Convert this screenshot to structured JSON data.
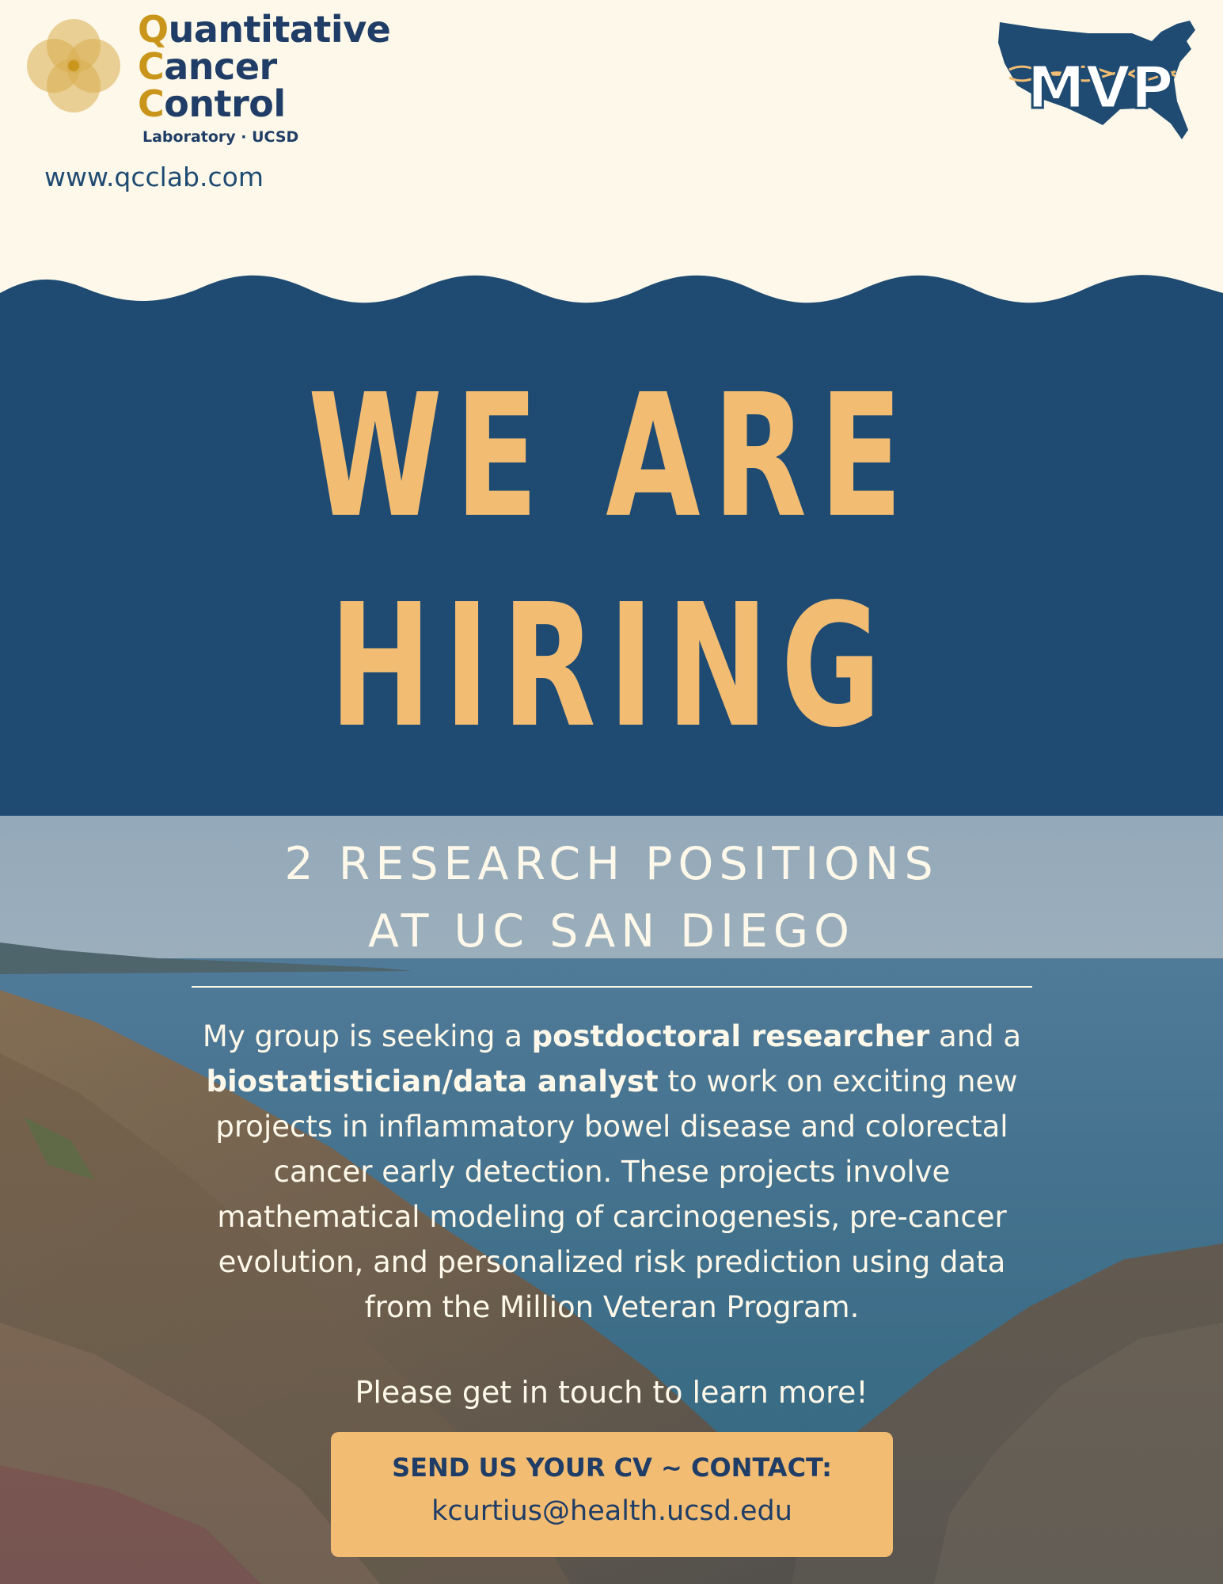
{
  "header": {
    "lab_name_lines": [
      {
        "cap": "Q",
        "rest": "uantitative"
      },
      {
        "cap": "C",
        "rest": "ancer"
      },
      {
        "cap": "C",
        "rest": "ontrol"
      }
    ],
    "lab_subtitle": "Laboratory  ·  UCSD",
    "website": "www.qcclab.com",
    "mvp_logo_text": "MVP"
  },
  "banner": {
    "line1": "WE ARE",
    "line2": "HIRING"
  },
  "positions": {
    "line1": "2 RESEARCH POSITIONS",
    "line2": "AT UC SAN DIEGO"
  },
  "description": {
    "part1": "My group is seeking a ",
    "bold1": "postdoctoral researcher",
    "part2": " and a ",
    "bold2": "biostatistician/data analyst",
    "part3": " to work on exciting new projects in inflammatory bowel disease and colorectal cancer early detection. These projects involve mathematical modeling of carcinogenesis, pre-cancer evolution, and personalized risk prediction using data from the Million Veteran Program."
  },
  "touch_text": "Please get in touch to learn more!",
  "cta": {
    "line1": "SEND US YOUR CV  ~  CONTACT:",
    "email": "kcurtius@health.ucsd.edu"
  },
  "colors": {
    "background": "#fdf8e9",
    "navy": "#1f4b73",
    "gold": "#f2bd73",
    "logo_gold": "#c9961b"
  }
}
